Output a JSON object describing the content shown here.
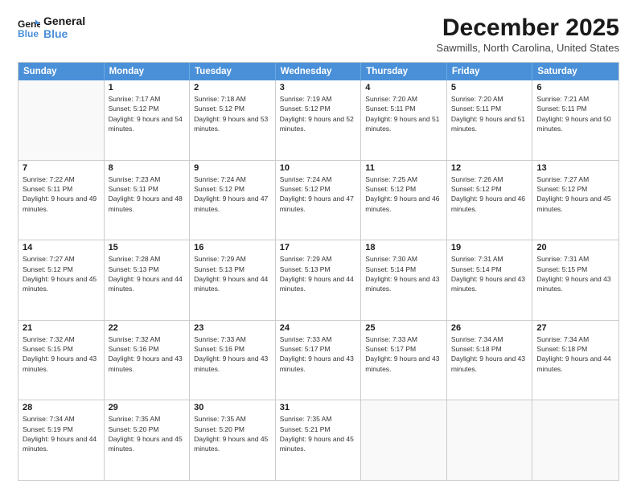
{
  "logo": {
    "line1": "General",
    "line2": "Blue"
  },
  "title": "December 2025",
  "location": "Sawmills, North Carolina, United States",
  "days": [
    "Sunday",
    "Monday",
    "Tuesday",
    "Wednesday",
    "Thursday",
    "Friday",
    "Saturday"
  ],
  "weeks": [
    [
      {
        "date": "",
        "sunrise": "",
        "sunset": "",
        "daylight": ""
      },
      {
        "date": "1",
        "sunrise": "Sunrise: 7:17 AM",
        "sunset": "Sunset: 5:12 PM",
        "daylight": "Daylight: 9 hours and 54 minutes."
      },
      {
        "date": "2",
        "sunrise": "Sunrise: 7:18 AM",
        "sunset": "Sunset: 5:12 PM",
        "daylight": "Daylight: 9 hours and 53 minutes."
      },
      {
        "date": "3",
        "sunrise": "Sunrise: 7:19 AM",
        "sunset": "Sunset: 5:12 PM",
        "daylight": "Daylight: 9 hours and 52 minutes."
      },
      {
        "date": "4",
        "sunrise": "Sunrise: 7:20 AM",
        "sunset": "Sunset: 5:11 PM",
        "daylight": "Daylight: 9 hours and 51 minutes."
      },
      {
        "date": "5",
        "sunrise": "Sunrise: 7:20 AM",
        "sunset": "Sunset: 5:11 PM",
        "daylight": "Daylight: 9 hours and 51 minutes."
      },
      {
        "date": "6",
        "sunrise": "Sunrise: 7:21 AM",
        "sunset": "Sunset: 5:11 PM",
        "daylight": "Daylight: 9 hours and 50 minutes."
      }
    ],
    [
      {
        "date": "7",
        "sunrise": "Sunrise: 7:22 AM",
        "sunset": "Sunset: 5:11 PM",
        "daylight": "Daylight: 9 hours and 49 minutes."
      },
      {
        "date": "8",
        "sunrise": "Sunrise: 7:23 AM",
        "sunset": "Sunset: 5:11 PM",
        "daylight": "Daylight: 9 hours and 48 minutes."
      },
      {
        "date": "9",
        "sunrise": "Sunrise: 7:24 AM",
        "sunset": "Sunset: 5:12 PM",
        "daylight": "Daylight: 9 hours and 47 minutes."
      },
      {
        "date": "10",
        "sunrise": "Sunrise: 7:24 AM",
        "sunset": "Sunset: 5:12 PM",
        "daylight": "Daylight: 9 hours and 47 minutes."
      },
      {
        "date": "11",
        "sunrise": "Sunrise: 7:25 AM",
        "sunset": "Sunset: 5:12 PM",
        "daylight": "Daylight: 9 hours and 46 minutes."
      },
      {
        "date": "12",
        "sunrise": "Sunrise: 7:26 AM",
        "sunset": "Sunset: 5:12 PM",
        "daylight": "Daylight: 9 hours and 46 minutes."
      },
      {
        "date": "13",
        "sunrise": "Sunrise: 7:27 AM",
        "sunset": "Sunset: 5:12 PM",
        "daylight": "Daylight: 9 hours and 45 minutes."
      }
    ],
    [
      {
        "date": "14",
        "sunrise": "Sunrise: 7:27 AM",
        "sunset": "Sunset: 5:12 PM",
        "daylight": "Daylight: 9 hours and 45 minutes."
      },
      {
        "date": "15",
        "sunrise": "Sunrise: 7:28 AM",
        "sunset": "Sunset: 5:13 PM",
        "daylight": "Daylight: 9 hours and 44 minutes."
      },
      {
        "date": "16",
        "sunrise": "Sunrise: 7:29 AM",
        "sunset": "Sunset: 5:13 PM",
        "daylight": "Daylight: 9 hours and 44 minutes."
      },
      {
        "date": "17",
        "sunrise": "Sunrise: 7:29 AM",
        "sunset": "Sunset: 5:13 PM",
        "daylight": "Daylight: 9 hours and 44 minutes."
      },
      {
        "date": "18",
        "sunrise": "Sunrise: 7:30 AM",
        "sunset": "Sunset: 5:14 PM",
        "daylight": "Daylight: 9 hours and 43 minutes."
      },
      {
        "date": "19",
        "sunrise": "Sunrise: 7:31 AM",
        "sunset": "Sunset: 5:14 PM",
        "daylight": "Daylight: 9 hours and 43 minutes."
      },
      {
        "date": "20",
        "sunrise": "Sunrise: 7:31 AM",
        "sunset": "Sunset: 5:15 PM",
        "daylight": "Daylight: 9 hours and 43 minutes."
      }
    ],
    [
      {
        "date": "21",
        "sunrise": "Sunrise: 7:32 AM",
        "sunset": "Sunset: 5:15 PM",
        "daylight": "Daylight: 9 hours and 43 minutes."
      },
      {
        "date": "22",
        "sunrise": "Sunrise: 7:32 AM",
        "sunset": "Sunset: 5:16 PM",
        "daylight": "Daylight: 9 hours and 43 minutes."
      },
      {
        "date": "23",
        "sunrise": "Sunrise: 7:33 AM",
        "sunset": "Sunset: 5:16 PM",
        "daylight": "Daylight: 9 hours and 43 minutes."
      },
      {
        "date": "24",
        "sunrise": "Sunrise: 7:33 AM",
        "sunset": "Sunset: 5:17 PM",
        "daylight": "Daylight: 9 hours and 43 minutes."
      },
      {
        "date": "25",
        "sunrise": "Sunrise: 7:33 AM",
        "sunset": "Sunset: 5:17 PM",
        "daylight": "Daylight: 9 hours and 43 minutes."
      },
      {
        "date": "26",
        "sunrise": "Sunrise: 7:34 AM",
        "sunset": "Sunset: 5:18 PM",
        "daylight": "Daylight: 9 hours and 43 minutes."
      },
      {
        "date": "27",
        "sunrise": "Sunrise: 7:34 AM",
        "sunset": "Sunset: 5:18 PM",
        "daylight": "Daylight: 9 hours and 44 minutes."
      }
    ],
    [
      {
        "date": "28",
        "sunrise": "Sunrise: 7:34 AM",
        "sunset": "Sunset: 5:19 PM",
        "daylight": "Daylight: 9 hours and 44 minutes."
      },
      {
        "date": "29",
        "sunrise": "Sunrise: 7:35 AM",
        "sunset": "Sunset: 5:20 PM",
        "daylight": "Daylight: 9 hours and 45 minutes."
      },
      {
        "date": "30",
        "sunrise": "Sunrise: 7:35 AM",
        "sunset": "Sunset: 5:20 PM",
        "daylight": "Daylight: 9 hours and 45 minutes."
      },
      {
        "date": "31",
        "sunrise": "Sunrise: 7:35 AM",
        "sunset": "Sunset: 5:21 PM",
        "daylight": "Daylight: 9 hours and 45 minutes."
      },
      {
        "date": "",
        "sunrise": "",
        "sunset": "",
        "daylight": ""
      },
      {
        "date": "",
        "sunrise": "",
        "sunset": "",
        "daylight": ""
      },
      {
        "date": "",
        "sunrise": "",
        "sunset": "",
        "daylight": ""
      }
    ]
  ]
}
